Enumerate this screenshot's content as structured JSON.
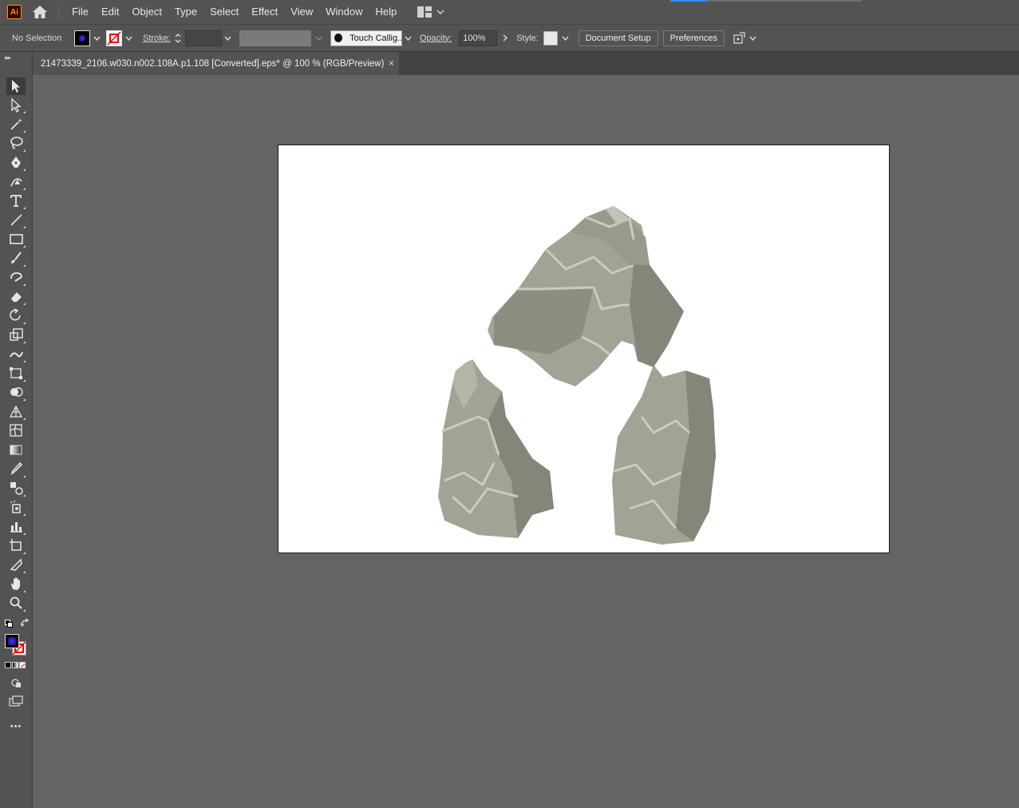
{
  "app": {
    "logo_text": "Ai"
  },
  "menu": [
    "File",
    "Edit",
    "Object",
    "Type",
    "Select",
    "Effect",
    "View",
    "Window",
    "Help"
  ],
  "control_bar": {
    "selection_status": "No Selection",
    "stroke_label": "Stroke:",
    "brush_name": "Touch Callig...",
    "opacity_label": "Opacity:",
    "opacity_value": "100%",
    "style_label": "Style:",
    "document_setup": "Document Setup",
    "preferences": "Preferences"
  },
  "document_tab": {
    "title": "21473339_2106.w030.n002.108A.p1.108 [Converted].eps* @ 100 % (RGB/Preview)",
    "close": "×"
  },
  "toolbar": {
    "more": "•••",
    "tools": [
      "selection-tool",
      "direct-selection-tool",
      "magic-wand-tool",
      "lasso-tool",
      "pen-tool",
      "curvature-tool",
      "type-tool",
      "line-tool",
      "rectangle-tool",
      "paintbrush-tool",
      "shaper-tool",
      "eraser-tool",
      "rotate-tool",
      "scale-tool",
      "warp-tool",
      "free-transform-tool",
      "shape-builder-tool",
      "perspective-grid-tool",
      "mesh-tool",
      "gradient-tool",
      "eyedropper-tool",
      "blend-tool",
      "symbol-sprayer-tool",
      "column-graph-tool",
      "artboard-tool",
      "slice-tool",
      "hand-tool",
      "zoom-tool"
    ]
  },
  "colors": {
    "fill": "#1a0a6b",
    "accent": "#2e8df0",
    "rock_base": "#a3a395",
    "rock_dark": "#85857a",
    "rock_light": "#c9c9bd"
  }
}
